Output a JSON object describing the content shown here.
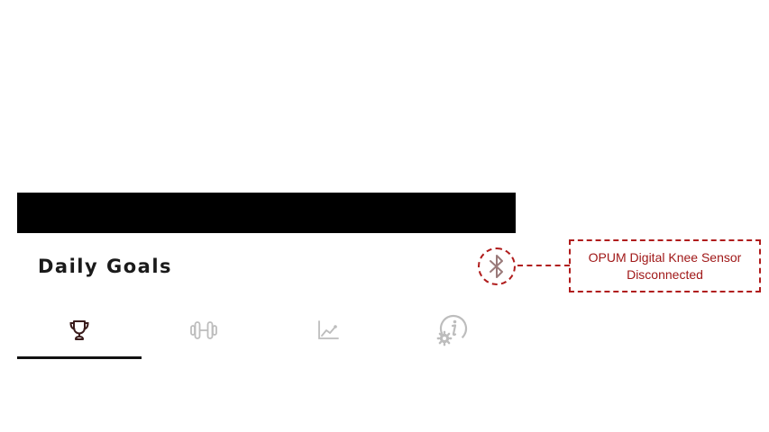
{
  "header": {
    "title": "Daily Goals"
  },
  "sensor": {
    "icon": "bluetooth-icon",
    "status_line1": "OPUM Digital Knee Sensor",
    "status_line2": "Disconnected",
    "accent_color": "#b01c1c"
  },
  "tabs": [
    {
      "icon": "trophy-icon",
      "active": true
    },
    {
      "icon": "dumbbell-icon",
      "active": false
    },
    {
      "icon": "chart-icon",
      "active": false
    },
    {
      "icon": "info-settings-icon",
      "active": false
    }
  ],
  "colors": {
    "status_bar": "#000000",
    "active_icon": "#3a1c1c",
    "inactive_icon": "#bdbdbd",
    "indicator": "#111111"
  }
}
